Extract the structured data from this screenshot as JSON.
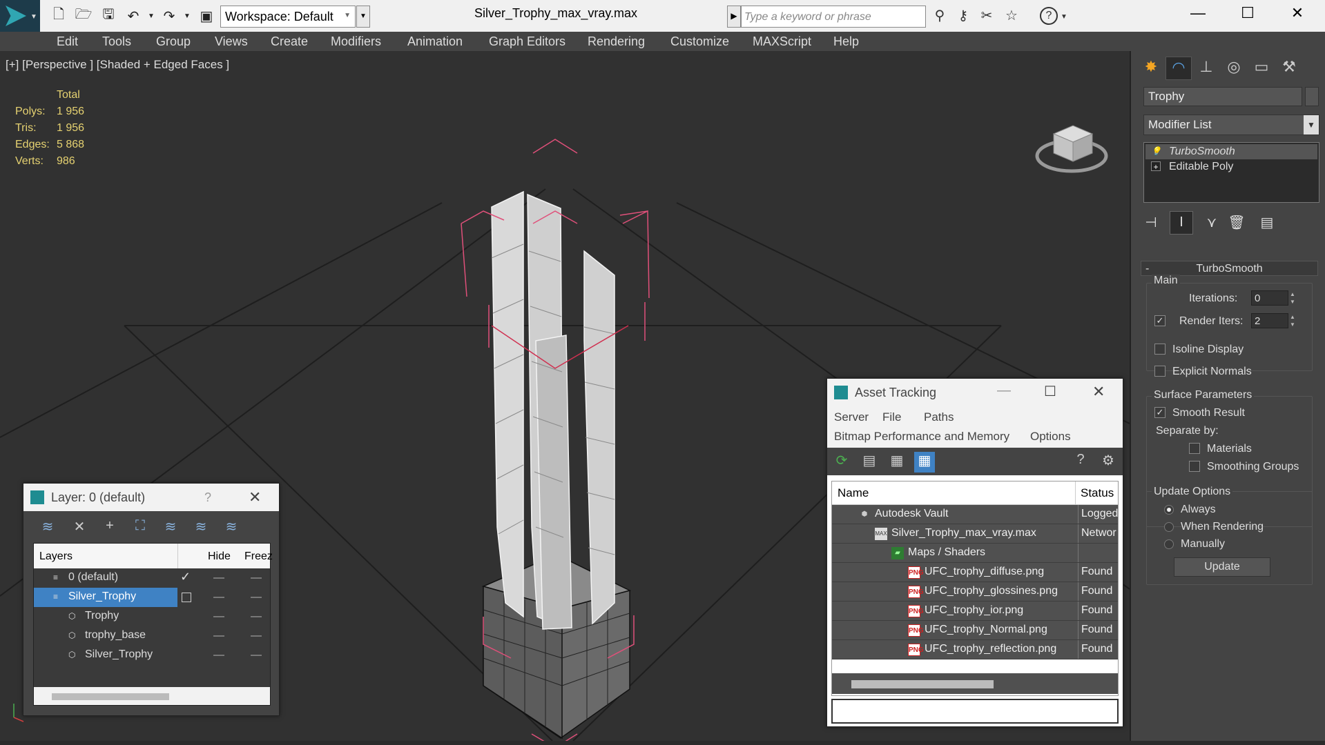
{
  "window": {
    "document_title": "Silver_Trophy_max_vray.max",
    "workspace_label": "Workspace: Default",
    "search_placeholder": "Type a keyword or phrase",
    "help_glyph": "?"
  },
  "menu": [
    "Edit",
    "Tools",
    "Group",
    "Views",
    "Create",
    "Modifiers",
    "Animation",
    "Graph Editors",
    "Rendering",
    "Customize",
    "MAXScript",
    "Help"
  ],
  "viewport": {
    "label": "[+] [Perspective ] [Shaded + Edged Faces ]",
    "stats": {
      "total_label": "Total",
      "rows": [
        {
          "key": "Polys:",
          "value": "1 956"
        },
        {
          "key": "Tris:",
          "value": "1 956"
        },
        {
          "key": "Edges:",
          "value": "5 868"
        },
        {
          "key": "Verts:",
          "value": "986"
        }
      ]
    }
  },
  "command_panel": {
    "object_name": "Trophy",
    "modifier_list": "Modifier List",
    "stack": [
      "TurboSmooth",
      "Editable Poly"
    ],
    "turbosmooth": {
      "title": "TurboSmooth",
      "collapse_glyph": "-",
      "main_label": "Main",
      "iterations_label": "Iterations:",
      "iterations_value": "0",
      "render_iters_label": "Render Iters:",
      "render_iters_value": "2",
      "render_iters_checked": true,
      "isoline_label": "Isoline Display",
      "explicit_normals_label": "Explicit Normals",
      "surface_params_label": "Surface Parameters",
      "smooth_result_label": "Smooth Result",
      "separate_by_label": "Separate by:",
      "materials_label": "Materials",
      "smoothing_groups_label": "Smoothing Groups",
      "update_options_label": "Update Options",
      "always_label": "Always",
      "when_rendering_label": "When Rendering",
      "manually_label": "Manually",
      "update_button": "Update"
    }
  },
  "layer_window": {
    "title": "Layer: 0 (default)",
    "help": "?",
    "columns": {
      "layers": "Layers",
      "hide": "Hide",
      "freeze": "Freez"
    },
    "rows": [
      {
        "name": "0 (default)",
        "indent": 0
      },
      {
        "name": "Silver_Trophy",
        "indent": 0,
        "selected": true
      },
      {
        "name": "Trophy",
        "indent": 1
      },
      {
        "name": "trophy_base",
        "indent": 1
      },
      {
        "name": "Silver_Trophy",
        "indent": 1
      }
    ]
  },
  "asset_window": {
    "title": "Asset Tracking",
    "menu_row1": [
      "Server",
      "File",
      "Paths"
    ],
    "menu_row2": [
      "Bitmap Performance and Memory",
      "Options"
    ],
    "columns": {
      "name": "Name",
      "status": "Status"
    },
    "rows": [
      {
        "name": "Autodesk Vault",
        "status": "Logged",
        "indent": 0,
        "icon": "vault"
      },
      {
        "name": "Silver_Trophy_max_vray.max",
        "status": "Networ",
        "indent": 1,
        "icon": "max"
      },
      {
        "name": "Maps / Shaders",
        "status": "",
        "indent": 2,
        "icon": "maps"
      },
      {
        "name": "UFC_trophy_diffuse.png",
        "status": "Found",
        "indent": 3,
        "icon": "png"
      },
      {
        "name": "UFC_trophy_glossines.png",
        "status": "Found",
        "indent": 3,
        "icon": "png"
      },
      {
        "name": "UFC_trophy_ior.png",
        "status": "Found",
        "indent": 3,
        "icon": "png"
      },
      {
        "name": "UFC_trophy_Normal.png",
        "status": "Found",
        "indent": 3,
        "icon": "png"
      },
      {
        "name": "UFC_trophy_reflection.png",
        "status": "Found",
        "indent": 3,
        "icon": "png"
      }
    ]
  },
  "colors": {
    "accent": "#3f82c4",
    "selection_pink": "#e0507a",
    "stats_yellow": "#e6d271",
    "viewport_bg": "#313131"
  }
}
